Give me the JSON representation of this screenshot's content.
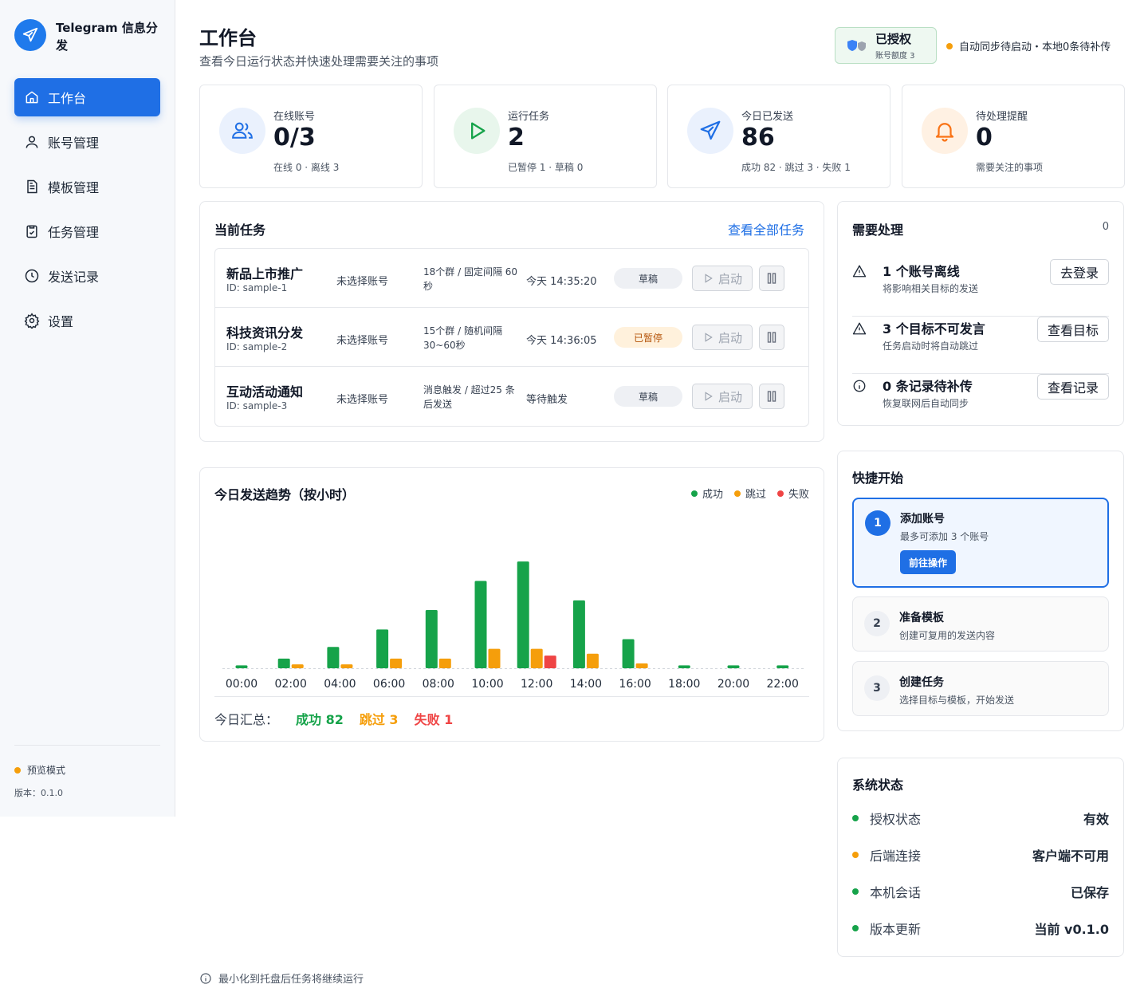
{
  "app": {
    "name": "Telegram 信息分发"
  },
  "nav": [
    {
      "label": "工作台",
      "icon": "home-icon"
    },
    {
      "label": "账号管理",
      "icon": "user-icon"
    },
    {
      "label": "模板管理",
      "icon": "document-icon"
    },
    {
      "label": "任务管理",
      "icon": "clipboard-icon"
    },
    {
      "label": "发送记录",
      "icon": "clock-icon"
    },
    {
      "label": "设置",
      "icon": "gear-icon"
    }
  ],
  "sidebar_footer": {
    "mode": "预览模式",
    "version": "版本：0.1.0"
  },
  "header": {
    "title": "工作台",
    "subtitle": "查看今日运行状态并快速处理需要关注的事项",
    "auth_title": "已授权",
    "auth_sub": "账号额度 3",
    "sync_status": "自动同步待启动・本地0条待补传"
  },
  "stats": [
    {
      "label": "在线账号",
      "value": "0/3",
      "sub": "在线 0 · 离线 3"
    },
    {
      "label": "运行任务",
      "value": "2",
      "sub": "已暂停 1 · 草稿 0"
    },
    {
      "label": "今日已发送",
      "value": "86",
      "sub": "成功 82 · 跳过 3 · 失败 1"
    },
    {
      "label": "待处理提醒",
      "value": "0",
      "sub": "需要关注的事项"
    }
  ],
  "current_tasks": {
    "title": "当前任务",
    "view_all": "查看全部任务",
    "rows": [
      {
        "name": "新品上市推广",
        "id": "ID: sample-1",
        "account": "未选择账号",
        "groups": "18个群 / 固定间隔 60秒",
        "time": "今天 14:35:20",
        "status": "草稿",
        "start": "启动"
      },
      {
        "name": "科技资讯分发",
        "id": "ID: sample-2",
        "account": "未选择账号",
        "groups": "15个群 / 随机间隔 30~60秒",
        "time": "今天 14:36:05",
        "status": "已暂停",
        "start": "启动"
      },
      {
        "name": "互动活动通知",
        "id": "ID: sample-3",
        "account": "未选择账号",
        "groups": "消息触发 / 超过25 条后发送",
        "time": "等待触发",
        "status": "草稿",
        "start": "启动"
      }
    ]
  },
  "needs_attention": {
    "title": "需要处理",
    "count": "0",
    "items": [
      {
        "title": "1 个账号离线",
        "sub": "将影响相关目标的发送",
        "button": "去登录",
        "icon": "warning-icon"
      },
      {
        "title": "3 个目标不可发言",
        "sub": "任务启动时将自动跳过",
        "button": "查看目标",
        "icon": "warning-icon"
      },
      {
        "title": "0 条记录待补传",
        "sub": "恢复联网后自动同步",
        "button": "查看记录",
        "icon": "info-icon"
      }
    ]
  },
  "quick_start": {
    "title": "快捷开始",
    "steps": [
      {
        "num": "1",
        "title": "添加账号",
        "desc": "最多可添加 3 个账号",
        "button": "前往操作"
      },
      {
        "num": "2",
        "title": "准备模板",
        "desc": "创建可复用的发送内容"
      },
      {
        "num": "3",
        "title": "创建任务",
        "desc": "选择目标与模板，开始发送"
      }
    ]
  },
  "system_status": {
    "title": "系统状态",
    "items": [
      {
        "label": "授权状态",
        "value": "有效",
        "color": "#16a34a"
      },
      {
        "label": "后端连接",
        "value": "客户端不可用",
        "color": "#f59e0b"
      },
      {
        "label": "本机会话",
        "value": "已保存",
        "color": "#16a34a"
      },
      {
        "label": "版本更新",
        "value": "当前 v0.1.0",
        "color": "#16a34a"
      }
    ]
  },
  "chart_data": {
    "type": "bar",
    "title": "今日发送趋势（按小时）",
    "categories": [
      "00:00",
      "02:00",
      "04:00",
      "06:00",
      "08:00",
      "10:00",
      "12:00",
      "14:00",
      "16:00",
      "18:00",
      "20:00",
      "22:00"
    ],
    "series": [
      {
        "name": "成功",
        "color": "#16a34a",
        "values": [
          0.3,
          1,
          2.2,
          4,
          6,
          9,
          11,
          7,
          3,
          0.3,
          0.3,
          0.3
        ]
      },
      {
        "name": "跳过",
        "color": "#f59e0b",
        "values": [
          0,
          0.4,
          0.4,
          1,
          1,
          2,
          2,
          1.5,
          0.5,
          0,
          0,
          0
        ]
      },
      {
        "name": "失败",
        "color": "#ef4444",
        "values": [
          0,
          0,
          0,
          0,
          0,
          0,
          1.3,
          0,
          0,
          0,
          0,
          0
        ]
      }
    ],
    "ylim": [
      0,
      12
    ],
    "legend": "top-right",
    "summary_label": "今日汇总：",
    "summary": [
      {
        "text": "成功 82",
        "color": "#16a34a"
      },
      {
        "text": "跳过 3",
        "color": "#f59e0b"
      },
      {
        "text": "失败 1",
        "color": "#ef4444"
      }
    ]
  },
  "footer": {
    "note": "最小化到托盘后任务将继续运行"
  },
  "colors": {
    "accent": "#1f6fe5",
    "success": "#16a34a",
    "warning": "#f59e0b",
    "danger": "#ef4444"
  }
}
